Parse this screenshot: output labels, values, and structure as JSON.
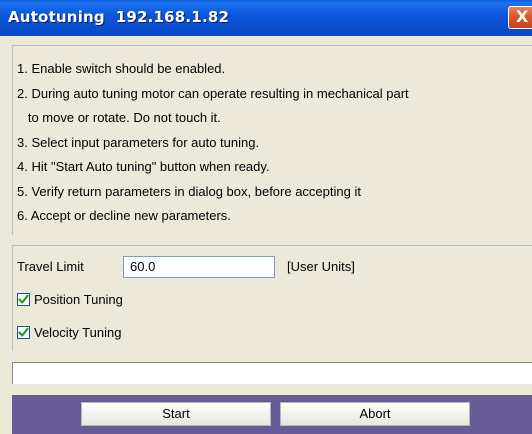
{
  "window": {
    "title": "Autotuning  192.168.1.82",
    "close_glyph": "X"
  },
  "instructions": [
    "1. Enable switch should be enabled.",
    "2. During auto tuning motor can operate resulting in mechanical part",
    "   to move or rotate. Do not touch it.",
    "3. Select input parameters for auto tuning.",
    "4. Hit \"Start Auto tuning\" button when ready.",
    "5. Verify return parameters in dialog box, before accepting it",
    "6. Accept or decline new parameters."
  ],
  "params": {
    "travel_limit_label": "Travel Limit",
    "travel_limit_value": "60.0",
    "travel_limit_units": "[User Units]",
    "position_tuning_label": "Position Tuning",
    "position_tuning_checked": true,
    "velocity_tuning_label": "Velocity Tuning",
    "velocity_tuning_checked": true
  },
  "status": {
    "text": ""
  },
  "buttons": {
    "start_label": "Start",
    "abort_label": "Abort"
  },
  "colors": {
    "title_bar": "#0c56dc",
    "dialog_background": "#ece9d8",
    "button_bar": "#675c97",
    "close_button": "#d9582f"
  }
}
